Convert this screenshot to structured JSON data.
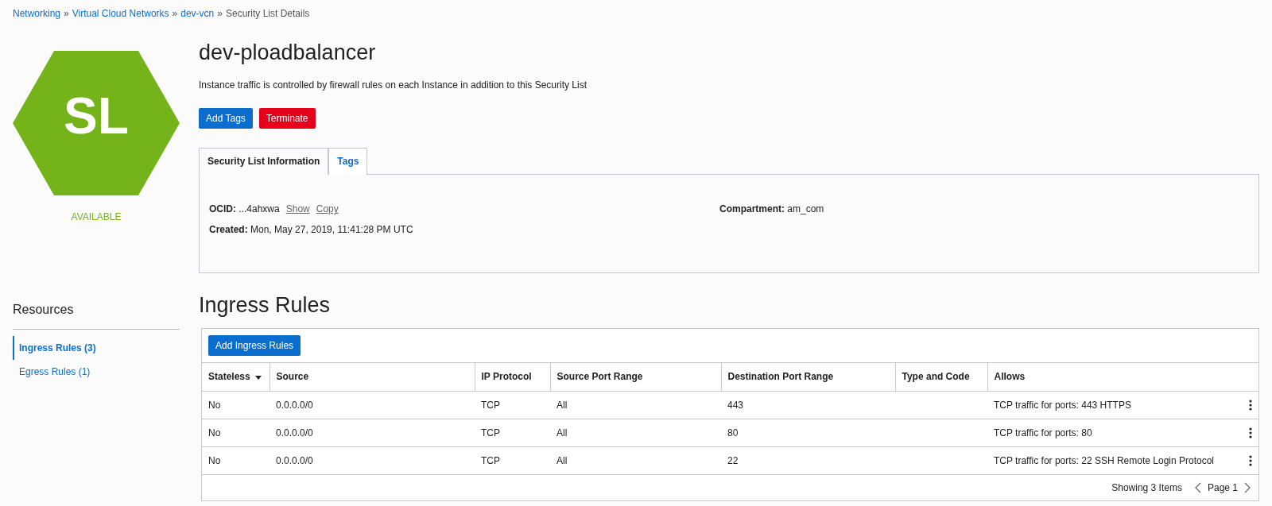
{
  "breadcrumbs": [
    {
      "label": "Networking",
      "kind": "link"
    },
    {
      "label": "Virtual Cloud Networks",
      "kind": "link"
    },
    {
      "label": "dev-vcn",
      "kind": "link"
    },
    {
      "label": "Security List Details",
      "kind": "current"
    }
  ],
  "separator": "»",
  "resource_icon": {
    "text": "SL",
    "status": "AVAILABLE"
  },
  "title": "dev-ploadbalancer",
  "description": "Instance traffic is controlled by firewall rules on each Instance in addition to this Security List",
  "actions": [
    {
      "label": "Add Tags",
      "kind": "primary"
    },
    {
      "label": "Terminate",
      "kind": "danger"
    }
  ],
  "tabs": [
    {
      "label": "Security List Information",
      "selected": true
    },
    {
      "label": "Tags",
      "selected": false
    }
  ],
  "info": {
    "ocid": {
      "label": "OCID:",
      "value": "...4ahxwa",
      "links": [
        "Show",
        "Copy"
      ]
    },
    "created": {
      "label": "Created:",
      "value": "Mon, May 27, 2019, 11:41:28 PM UTC"
    },
    "compartment": {
      "label": "Compartment:",
      "value": "am_com"
    }
  },
  "resources": {
    "title": "Resources",
    "items": [
      {
        "label": "Ingress Rules (3)",
        "selected": true
      },
      {
        "label": "Egress Rules (1)",
        "selected": false
      }
    ]
  },
  "section_title": "Ingress Rules",
  "add_button": "Add Ingress Rules",
  "table": {
    "columns": [
      {
        "label": "Stateless",
        "sorted": true
      },
      {
        "label": "Source",
        "sorted": false
      },
      {
        "label": "IP Protocol",
        "sorted": false
      },
      {
        "label": "Source Port Range",
        "sorted": false
      },
      {
        "label": "Destination Port Range",
        "sorted": false
      },
      {
        "label": "Type and Code",
        "sorted": false
      },
      {
        "label": "Allows",
        "sorted": false
      }
    ],
    "rows": [
      [
        "No",
        "0.0.0.0/0",
        "TCP",
        "All",
        "443",
        "",
        "TCP traffic for ports: 443 HTTPS"
      ],
      [
        "No",
        "0.0.0.0/0",
        "TCP",
        "All",
        "80",
        "",
        "TCP traffic for ports: 80"
      ],
      [
        "No",
        "0.0.0.0/0",
        "TCP",
        "All",
        "22",
        "",
        "TCP traffic for ports: 22 SSH Remote Login Protocol"
      ]
    ]
  },
  "footer": {
    "showing": "Showing 3 Items",
    "page": "Page 1"
  }
}
